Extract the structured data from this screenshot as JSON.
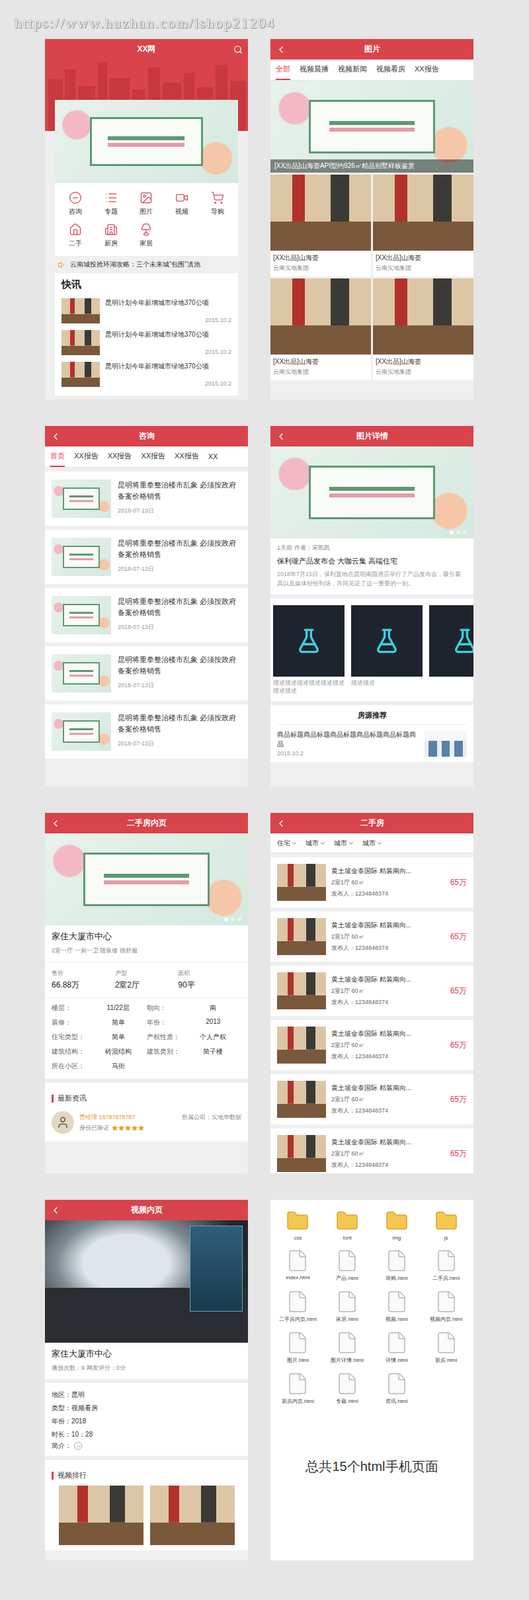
{
  "watermark": "https://www.huzhan.com/ishop21204",
  "home": {
    "title": "XX网",
    "nav": [
      "咨询",
      "专题",
      "图片",
      "视频",
      "导购",
      "二手",
      "新房",
      "家居"
    ],
    "notice": "云南城投抢环湖攻略：三个未来城“包围”滇池",
    "section": "快讯",
    "news": [
      {
        "title": "昆明计划今年新增城市绿地370公顷",
        "date": "2015.10.2"
      },
      {
        "title": "昆明计划今年新增城市绿地370公顷",
        "date": "2015.10.2"
      },
      {
        "title": "昆明计划今年新增城市绿地370公顷",
        "date": "2015.10.2"
      }
    ]
  },
  "gallery": {
    "title": "图片",
    "tabs": [
      {
        "label": "全部",
        "selected": true
      },
      {
        "label": "视频晨播",
        "selected": false
      },
      {
        "label": "视频新闻",
        "selected": false
      },
      {
        "label": "视频看房",
        "selected": false
      },
      {
        "label": "XX报告",
        "selected": false
      }
    ],
    "banner_caption": "[XX出品]山海荟API型约926㎡精品别墅样板鉴赏",
    "items": [
      {
        "title": "[XX出品]山海荟",
        "source": "云南实地集团"
      },
      {
        "title": "[XX出品]山海荟",
        "source": "云南实地集团"
      },
      {
        "title": "[XX出品]山海荟",
        "source": "云南实地集团"
      },
      {
        "title": "[XX出品]山海荟",
        "source": "云南实地集团"
      }
    ]
  },
  "consult": {
    "title": "咨询",
    "tabs": [
      {
        "label": "首页",
        "selected": true
      },
      {
        "label": "XX报告",
        "selected": false
      },
      {
        "label": "XX报告",
        "selected": false
      },
      {
        "label": "XX报告",
        "selected": false
      },
      {
        "label": "XX报告",
        "selected": false
      },
      {
        "label": "XX",
        "selected": false
      }
    ],
    "articles": [
      {
        "title": "昆明将重拳整治楼市乱象 必须按政府备案价格销售",
        "date": "2018-07-13日"
      },
      {
        "title": "昆明将重拳整治楼市乱象 必须按政府备案价格销售",
        "date": "2018-07-13日"
      },
      {
        "title": "昆明将重拳整治楼市乱象 必须按政府备案价格销售",
        "date": "2018-07-13日"
      },
      {
        "title": "昆明将重拳整治楼市乱象 必须按政府备案价格销售",
        "date": "2018-07-13日"
      },
      {
        "title": "昆明将重拳整治楼市乱象 必须按政府备案价格销售",
        "date": "2018-07-13日"
      }
    ]
  },
  "photo_detail": {
    "title": "图片详情",
    "slides": [
      {
        "selected": true
      },
      {
        "selected": false
      },
      {
        "selected": false
      }
    ],
    "meta": "1天前 作者：宋凯凯",
    "headline": "保利瓏产品发布会 大咖云集 高端住宅",
    "description": "2018年7月15日，保利置地在昆明南园酒店举行了产品发布会，吸引着具以及媒体纷纷到场，共同见证了这一重要的一刻。",
    "cards": [
      {
        "caption": "描述描述描述描述描述描述描述描述"
      },
      {
        "caption": "描述描述"
      },
      {}
    ],
    "recommend_title": "房源推荐",
    "recommend": {
      "title": "商品标题商品标题商品标题商品标题商品标题商品",
      "date": "2015.10.2"
    }
  },
  "house_detail": {
    "title": "二手房内页",
    "slides": [
      {
        "selected": true
      },
      {
        "selected": false
      },
      {
        "selected": false
      }
    ],
    "name": "家住大厦市中心",
    "summary": "2室一厅 一厨一卫 随装修 很舒服",
    "stats": [
      {
        "label": "售价",
        "value": "66.88万"
      },
      {
        "label": "户型",
        "value": "2室2厅"
      },
      {
        "label": "面积",
        "value": "90平"
      }
    ],
    "details": [
      {
        "label": "楼层：",
        "value": "11/22层"
      },
      {
        "label": "朝向：",
        "value": "南"
      },
      {
        "label": "装修：",
        "value": "简单"
      },
      {
        "label": "年份：",
        "value": "2013"
      },
      {
        "label": "住宅类型：",
        "value": "简单"
      },
      {
        "label": "产权性质：",
        "value": "个人产权"
      },
      {
        "label": "建筑结构：",
        "value": "砖混结构"
      },
      {
        "label": "建筑类别：",
        "value": "简子楼"
      },
      {
        "label": "所在小区：",
        "value": "马街"
      }
    ],
    "section": "最新资讯",
    "agent": {
      "name": "曹经理",
      "phone": "18787878787",
      "company": "所属公司：实地华数据",
      "verified": "身份已验证",
      "stars": 5
    }
  },
  "houses": {
    "title": "二手房",
    "filters": [
      "住宅",
      "城市",
      "城市",
      "城市"
    ],
    "items": [
      {
        "title": "黄土坡金泰国际 精装南向...",
        "layout": "2室1厅 60㎡",
        "publisher": "发布人：1234848374",
        "price": "65万"
      },
      {
        "title": "黄土坡金泰国际 精装南向...",
        "layout": "2室1厅 60㎡",
        "publisher": "发布人：1234848374",
        "price": "65万"
      },
      {
        "title": "黄土坡金泰国际 精装南向...",
        "layout": "2室1厅 60㎡",
        "publisher": "发布人：1234848374",
        "price": "65万"
      },
      {
        "title": "黄土坡金泰国际 精装南向...",
        "layout": "2室1厅 60㎡",
        "publisher": "发布人：1234848374",
        "price": "65万"
      },
      {
        "title": "黄土坡金泰国际 精装南向...",
        "layout": "2室1厅 60㎡",
        "publisher": "发布人：1234848374",
        "price": "65万"
      },
      {
        "title": "黄土坡金泰国际 精装南向...",
        "layout": "2室1厅 60㎡",
        "publisher": "发布人：1234848374",
        "price": "65万"
      }
    ]
  },
  "video": {
    "title": "视频内页",
    "name": "家住大厦市中心",
    "stats": "播放次数：9 网友评分：0分",
    "info": [
      "地区：昆明",
      "类型：视频看房",
      "年份：2018",
      "时长：10：28"
    ],
    "intro_label": "简介：",
    "section": "视频排行",
    "ranking_count": 2
  },
  "files": {
    "folders": [
      "css",
      "font",
      "img",
      "js"
    ],
    "files": [
      "index.html",
      "产品.html",
      "导购.html",
      "二手房.html",
      "二手房内页.html",
      "家居.html",
      "视频.html",
      "视频内页.html",
      "图片.html",
      "图片详情.html",
      "详情.html",
      "新房.html",
      "新房内页.html",
      "专题.html",
      "资讯.html"
    ],
    "summary": "总共15个html手机页面"
  }
}
